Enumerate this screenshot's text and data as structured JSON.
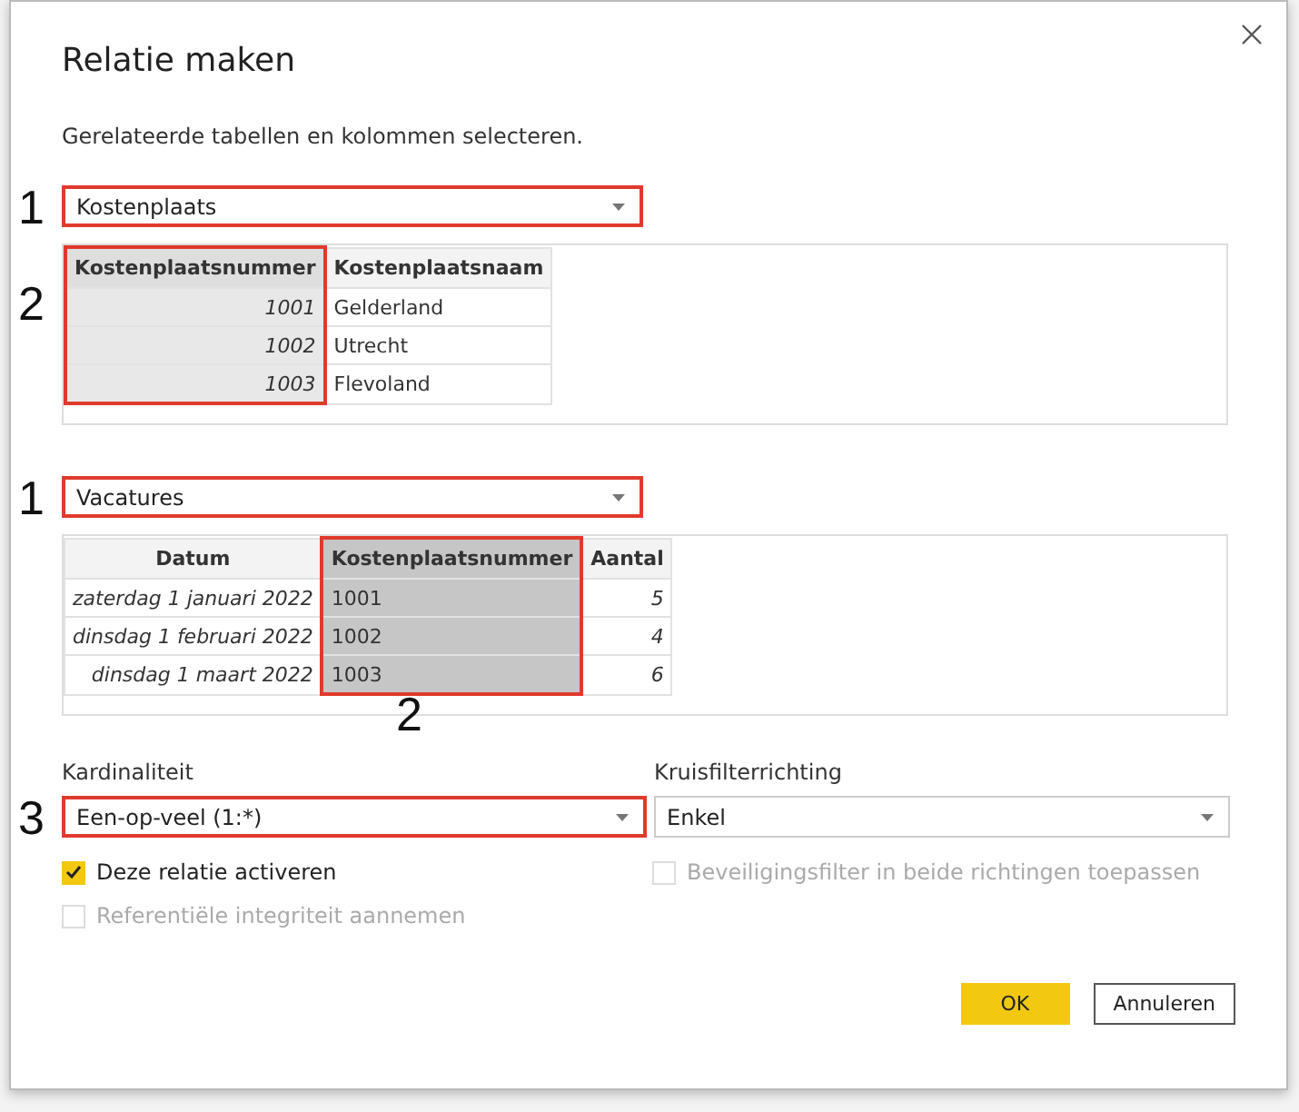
{
  "dialog": {
    "title": "Relatie maken",
    "subtitle": "Gerelateerde tabellen en kolommen selecteren."
  },
  "tables": [
    {
      "marker": "1",
      "dropdown": {
        "value": "Kostenplaats",
        "highlighted": true
      },
      "column_marker": {
        "text": "2",
        "kind": "side"
      },
      "columns": [
        {
          "header": "Kostenplaatsnummer",
          "kind": "number",
          "selected": true,
          "highlighted": true
        },
        {
          "header": "Kostenplaatsnaam",
          "kind": "text",
          "selected": false,
          "highlighted": false
        }
      ],
      "rows": [
        [
          "1001",
          "Gelderland"
        ],
        [
          "1002",
          "Utrecht"
        ],
        [
          "1003",
          "Flevoland"
        ]
      ]
    },
    {
      "marker": "1",
      "dropdown": {
        "value": "Vacatures",
        "highlighted": true
      },
      "column_marker": {
        "text": "2",
        "kind": "below"
      },
      "columns": [
        {
          "header": "Datum",
          "kind": "date",
          "selected": false,
          "highlighted": false
        },
        {
          "header": "Kostenplaatsnummer",
          "kind": "text",
          "selected": true,
          "highlighted": true
        },
        {
          "header": "Aantal",
          "kind": "number",
          "selected": false,
          "highlighted": false
        }
      ],
      "rows": [
        [
          "zaterdag 1 januari 2022",
          "1001",
          "5"
        ],
        [
          "dinsdag 1 februari 2022",
          "1002",
          "4"
        ],
        [
          "dinsdag 1 maart 2022",
          "1003",
          "6"
        ]
      ]
    }
  ],
  "cardinality": {
    "label": "Kardinaliteit",
    "marker": "3",
    "value": "Een-op-veel (1:*)",
    "highlighted": true
  },
  "crossfilter": {
    "label": "Kruisfilterrichting",
    "value": "Enkel",
    "highlighted": false
  },
  "options": [
    {
      "label": "Deze relatie activeren",
      "checked": true,
      "disabled": false
    },
    {
      "label": "Beveiligingsfilter in beide richtingen toepassen",
      "checked": false,
      "disabled": true
    },
    {
      "label": "Referentiële integriteit aannemen",
      "checked": false,
      "disabled": true
    }
  ],
  "buttons": [
    {
      "label": "OK",
      "kind": "primary"
    },
    {
      "label": "Annuleren",
      "kind": "secondary"
    }
  ]
}
